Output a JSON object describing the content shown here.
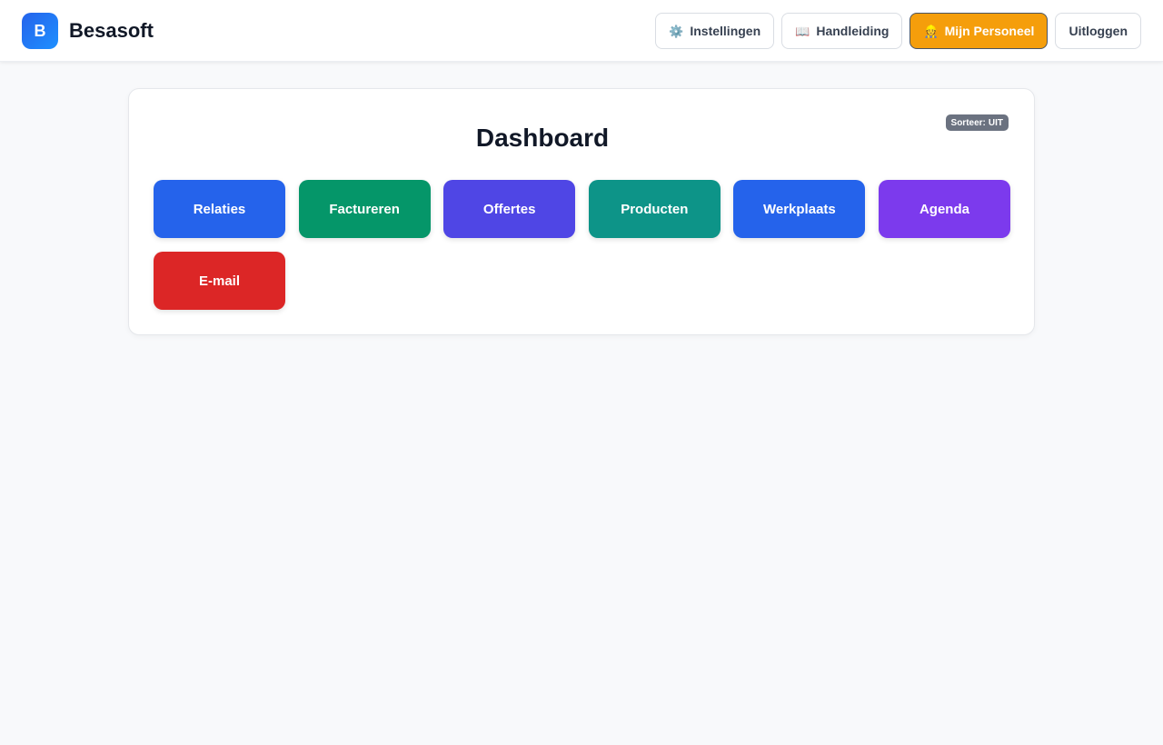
{
  "header": {
    "logo_letter": "B",
    "brand": "Besasoft",
    "nav": [
      {
        "icon": "⚙️",
        "icon_name": "gear-icon",
        "label": "Instellingen",
        "style": "default"
      },
      {
        "icon": "📖",
        "icon_name": "book-icon",
        "label": "Handleiding",
        "style": "default"
      },
      {
        "icon": "👷",
        "icon_name": "worker-icon",
        "label": "Mijn Personeel",
        "style": "accent",
        "color": "#f59e0b"
      },
      {
        "icon": "",
        "icon_name": "",
        "label": "Uitloggen",
        "style": "default"
      }
    ]
  },
  "dashboard": {
    "title": "Dashboard",
    "sort_label": "Sorteer:",
    "sort_value": "UIT",
    "tiles": [
      {
        "label": "Relaties",
        "color": "#2563eb"
      },
      {
        "label": "Factureren",
        "color": "#059669"
      },
      {
        "label": "Offertes",
        "color": "#4f46e5"
      },
      {
        "label": "Producten",
        "color": "#0d9488"
      },
      {
        "label": "Werkplaats",
        "color": "#2563eb"
      },
      {
        "label": "Agenda",
        "color": "#7c3aed"
      },
      {
        "label": "E-mail",
        "color": "#dc2626"
      }
    ]
  }
}
